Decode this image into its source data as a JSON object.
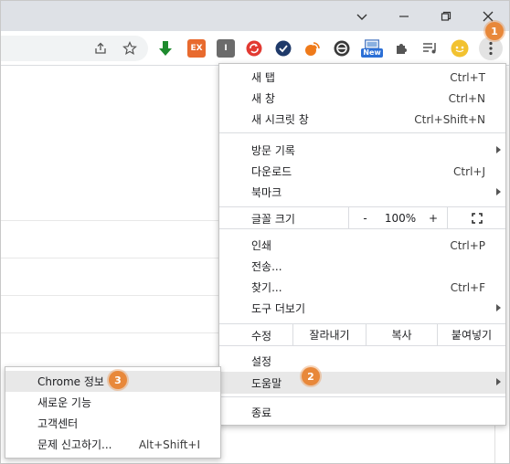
{
  "badges": {
    "menu_button": "1",
    "help_item": "2",
    "about_item": "3"
  },
  "extensions": {
    "ex_label": "EX",
    "i_label": "I",
    "new_badge": "New"
  },
  "menu": {
    "new_tab": {
      "label": "새 탭",
      "shortcut": "Ctrl+T"
    },
    "new_window": {
      "label": "새 창",
      "shortcut": "Ctrl+N"
    },
    "incognito": {
      "label": "새 시크릿 창",
      "shortcut": "Ctrl+Shift+N"
    },
    "history": {
      "label": "방문 기록"
    },
    "downloads": {
      "label": "다운로드",
      "shortcut": "Ctrl+J"
    },
    "bookmarks": {
      "label": "북마크"
    },
    "zoom": {
      "label": "글꼴 크기",
      "minus": "-",
      "value": "100%",
      "plus": "+"
    },
    "print": {
      "label": "인쇄",
      "shortcut": "Ctrl+P"
    },
    "cast": {
      "label": "전송..."
    },
    "find": {
      "label": "찾기...",
      "shortcut": "Ctrl+F"
    },
    "more_tools": {
      "label": "도구 더보기"
    },
    "edit": {
      "label": "수정",
      "cut": "잘라내기",
      "copy": "복사",
      "paste": "붙여넣기"
    },
    "settings": {
      "label": "설정"
    },
    "help": {
      "label": "도움말"
    },
    "exit": {
      "label": "종료"
    }
  },
  "help_submenu": {
    "about": {
      "label": "Chrome 정보"
    },
    "whats_new": {
      "label": "새로운 기능"
    },
    "help_center": {
      "label": "고객센터"
    },
    "report_issue": {
      "label": "문제 신고하기...",
      "shortcut": "Alt+Shift+I"
    }
  },
  "colors": {
    "badge": "#e8883a",
    "titlebar": "#dee1e6",
    "highlight": "#e8e8e8"
  }
}
